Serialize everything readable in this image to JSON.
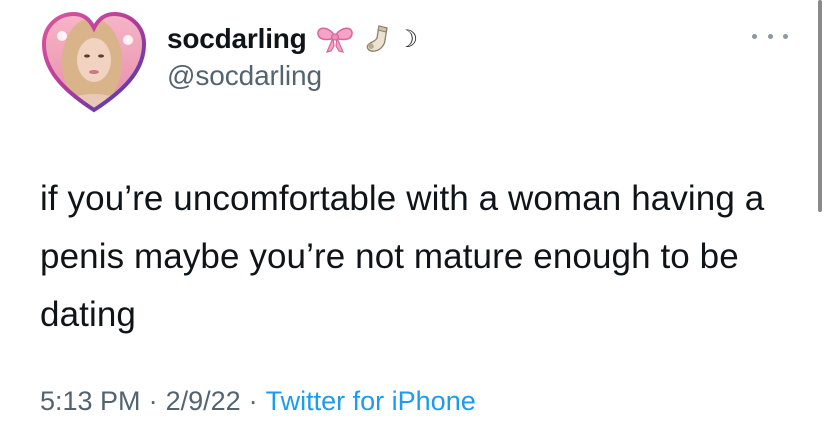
{
  "tweet": {
    "display_name": "socdarling",
    "name_emoji_icons": [
      "ribbon-bow-icon",
      "sock-icon",
      "crescent-moon-icon"
    ],
    "moon_glyph": "☽",
    "handle": "@socdarling",
    "text": "if you’re uncomfortable with a woman having a penis maybe you’re not mature enough to be dating",
    "time": "5:13 PM",
    "separator": "·",
    "date": "2/9/22",
    "source": "Twitter for iPhone"
  },
  "colors": {
    "text": "#0f1419",
    "secondary": "#536471",
    "link": "#1d9bf0",
    "avatar_frame": "#7a2fa0"
  }
}
